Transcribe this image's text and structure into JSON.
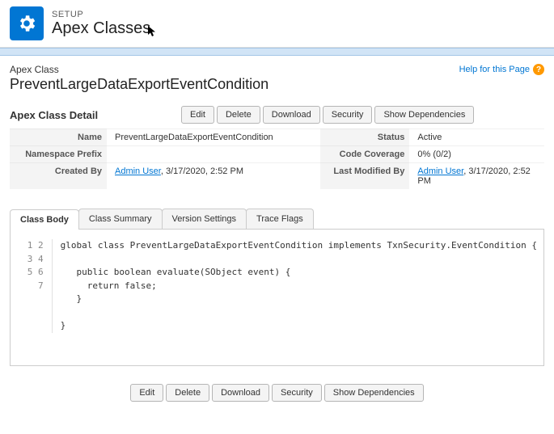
{
  "header": {
    "setup_label": "SETUP",
    "page_title": "Apex Classes"
  },
  "content": {
    "breadcrumb": "Apex Class",
    "class_name": "PreventLargeDataExportEventCondition",
    "help_text": "Help for this Page"
  },
  "detail": {
    "title": "Apex Class Detail",
    "buttons": {
      "edit": "Edit",
      "delete": "Delete",
      "download": "Download",
      "security": "Security",
      "show_deps": "Show Dependencies"
    },
    "fields": {
      "name_label": "Name",
      "name_value": "PreventLargeDataExportEventCondition",
      "status_label": "Status",
      "status_value": "Active",
      "namespace_label": "Namespace Prefix",
      "namespace_value": "",
      "coverage_label": "Code Coverage",
      "coverage_value": "0% (0/2)",
      "created_by_label": "Created By",
      "created_by_user": "Admin User",
      "created_by_date": ",  3/17/2020, 2:52 PM",
      "modified_by_label": "Last Modified By",
      "modified_by_user": "Admin User",
      "modified_by_date": ",  3/17/2020, 2:52 PM"
    }
  },
  "tabs": {
    "class_body": "Class Body",
    "class_summary": "Class Summary",
    "version_settings": "Version Settings",
    "trace_flags": "Trace Flags"
  },
  "code": {
    "line_numbers": "1\n2\n3\n4\n5\n6\n7",
    "body": "global class PreventLargeDataExportEventCondition implements TxnSecurity.EventCondition {\n\n   public boolean evaluate(SObject event) {\n     return false;\n   }\n\n}"
  }
}
